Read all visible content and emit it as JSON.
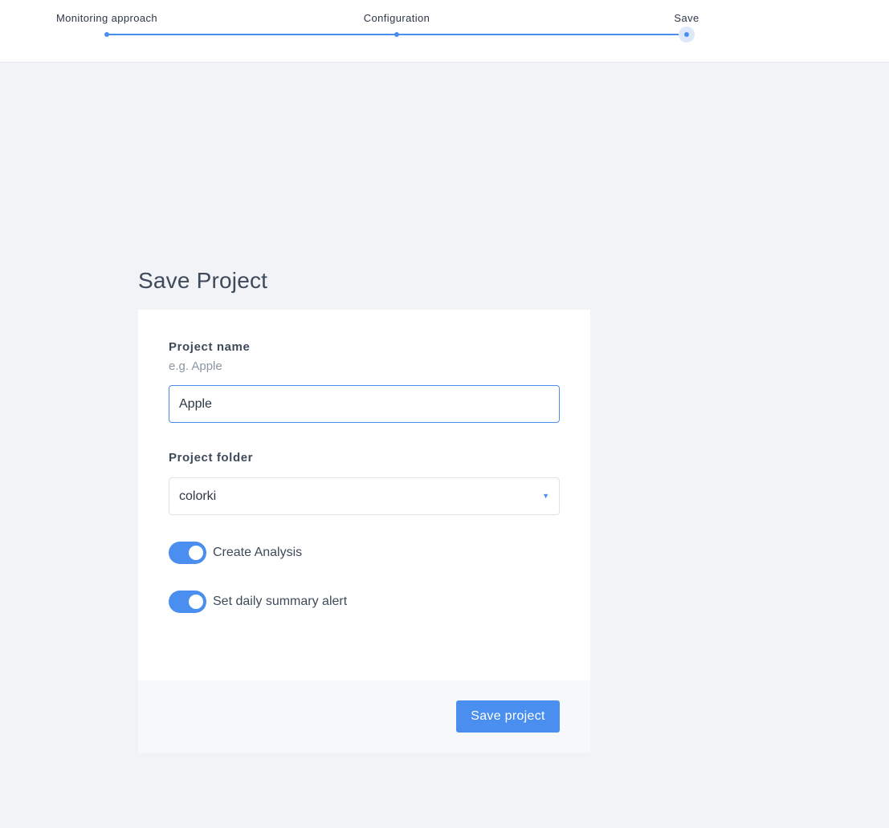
{
  "stepper": {
    "steps": [
      {
        "label": "Monitoring approach",
        "state": "complete"
      },
      {
        "label": "Configuration",
        "state": "complete"
      },
      {
        "label": "Save",
        "state": "current"
      }
    ],
    "accent_color": "#4a8ff0"
  },
  "page": {
    "title": "Save Project"
  },
  "form": {
    "project_name": {
      "label": "Project name",
      "hint": "e.g. Apple",
      "value": "Apple"
    },
    "project_folder": {
      "label": "Project folder",
      "value": "colorki",
      "caret_icon": "caret-down-icon"
    },
    "toggles": [
      {
        "label": "Create Analysis",
        "on": true
      },
      {
        "label": "Set daily summary alert",
        "on": true
      }
    ],
    "submit_label": "Save project"
  }
}
